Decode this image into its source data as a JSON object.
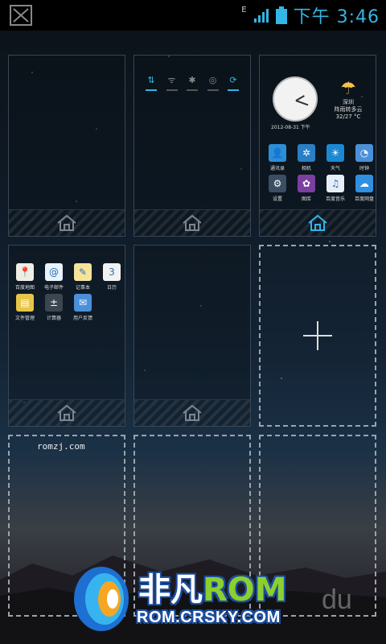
{
  "status_bar": {
    "network": "E",
    "time": "下午 3:46",
    "accent_color": "#33b5e5"
  },
  "tiles": {
    "tile2_toggles": [
      {
        "name": "data-toggle-icon",
        "glyph": "⇅",
        "on": true
      },
      {
        "name": "wifi-toggle-icon",
        "glyph": "ᯤ",
        "on": false
      },
      {
        "name": "bluetooth-toggle-icon",
        "glyph": "✱",
        "on": false
      },
      {
        "name": "brightness-toggle-icon",
        "glyph": "◎",
        "on": false
      },
      {
        "name": "sync-toggle-icon",
        "glyph": "⟳",
        "on": true
      }
    ],
    "tile3": {
      "date": "2012-08-31 下午",
      "weather_city": "深圳",
      "weather_desc": "阵雨转多云",
      "weather_temp": "32/27 °C",
      "apps": [
        "通讯录",
        "相机",
        "天气",
        "时钟",
        "设置",
        "图库",
        "百度音乐",
        "百度网盘"
      ]
    },
    "tile4": {
      "apps": [
        "百度地图",
        "电子邮件",
        "记事本",
        "日历",
        "文件管理",
        "计算器",
        "用户反馈"
      ]
    },
    "tile7_text": "romzj.com"
  },
  "watermark": {
    "main_prefix": "非凡",
    "main_rom": "ROM",
    "sub": "ROM.CRSKY.COM",
    "du": "du"
  }
}
